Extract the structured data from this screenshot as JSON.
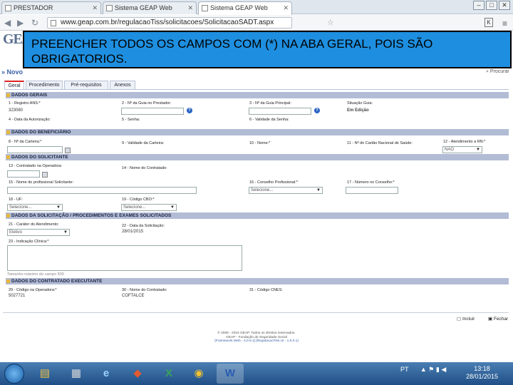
{
  "browser": {
    "tabs": [
      "PRESTADOR",
      "Sistema GEAP Web",
      "Sistema GEAP Web"
    ],
    "url": "www.geap.com.br/regulacaoTiss/solicitacoes/SolicitacaoSADT.aspx",
    "window_controls": [
      "–",
      "□",
      "✕"
    ]
  },
  "logo": "GEAP",
  "banner": "PREENCHER TODOS OS CAMPOS COM (*) NA ABA GERAL, POIS SÃO OBRIGATORIOS.",
  "page": {
    "novo": "» Novo",
    "procurar": "Procurar",
    "tabs": [
      "Geral",
      "Procedimento",
      "Pré-requisitos",
      "Anexos"
    ]
  },
  "sections": {
    "dados_gerais": "DADOS GERAIS",
    "beneficiario": "DADOS DO BENEFICIÁRIO",
    "solicitante": "DADOS DO SOLICITANTE",
    "solicitacao": "DADOS DA SOLICITAÇÃO / PROCEDIMENTOS E EXAMES SOLICITADOS",
    "executante": "DADOS DO CONTRATADO EXECUTANTE"
  },
  "fields": {
    "f1": "1 - Registro ANS:*",
    "f1_val": "323080",
    "f2": "2 - Nº da Guia no Prestador:",
    "f3": "3 - Nº da Guia Principal:",
    "sit": "Situação Guia:",
    "sit_val": "Em Edição",
    "f4": "4 - Data da Autorização:",
    "f5": "5 - Senha:",
    "f6": "6 - Validade da Senha:",
    "f8": "8 - Nº da Carteira:*",
    "f9": "9 - Validade da Carteira:",
    "f10": "10 - Nome:*",
    "f11": "11 - Nº do Cartão Nacional de Saúde:",
    "f12": "12 - Atendimento a RN:*",
    "f12_val": "NAO",
    "f13": "13 - Contratado na Operadora:",
    "f14": "14 - Nome do Contratado:",
    "f15": "15 - Nome do profissional Solicitante:",
    "f16": "16 - Conselho Profissional:*",
    "f16_val": "Selecione...",
    "f17": "17 - Número no Conselho:*",
    "f18": "18 - UF:",
    "f18_val": "Selecione...",
    "f19": "19 - Código CBO:*",
    "f19_val": "Selecione...",
    "f21": "21 - Caráter do Atendimento:",
    "f21_val": "Eletivo",
    "f22": "22 - Data da Solicitação:",
    "f22_val": "28/01/2015",
    "f23": "23 - Indicação Clínica:*",
    "ta_hint": "Tamanho máximo do campo 500",
    "f29": "29 - Código na Operadora:*",
    "f29_val": "5027721",
    "f30": "30 - Nome do Contratado:",
    "f30_val": "COFTALCE",
    "f31": "31 - Código CNES:"
  },
  "actions": {
    "incluir": "Incluir",
    "fechar": "Fechar"
  },
  "footer": [
    "© 2006 - 2015 GEAP. Todos os direitos reservados.",
    "GEAP - Fundação de Seguridade Social",
    "[Framework.Web - 3.0.9.1] [RegulacaoTiss.UI - 1.0.0.1]"
  ],
  "taskbar": {
    "lang": "PT",
    "time": "13:18",
    "date": "28/01/2015"
  },
  "colors": {
    "banner": "#1e8fe0",
    "section": "#b2bcd5",
    "taskbar": "#2b5f98"
  }
}
